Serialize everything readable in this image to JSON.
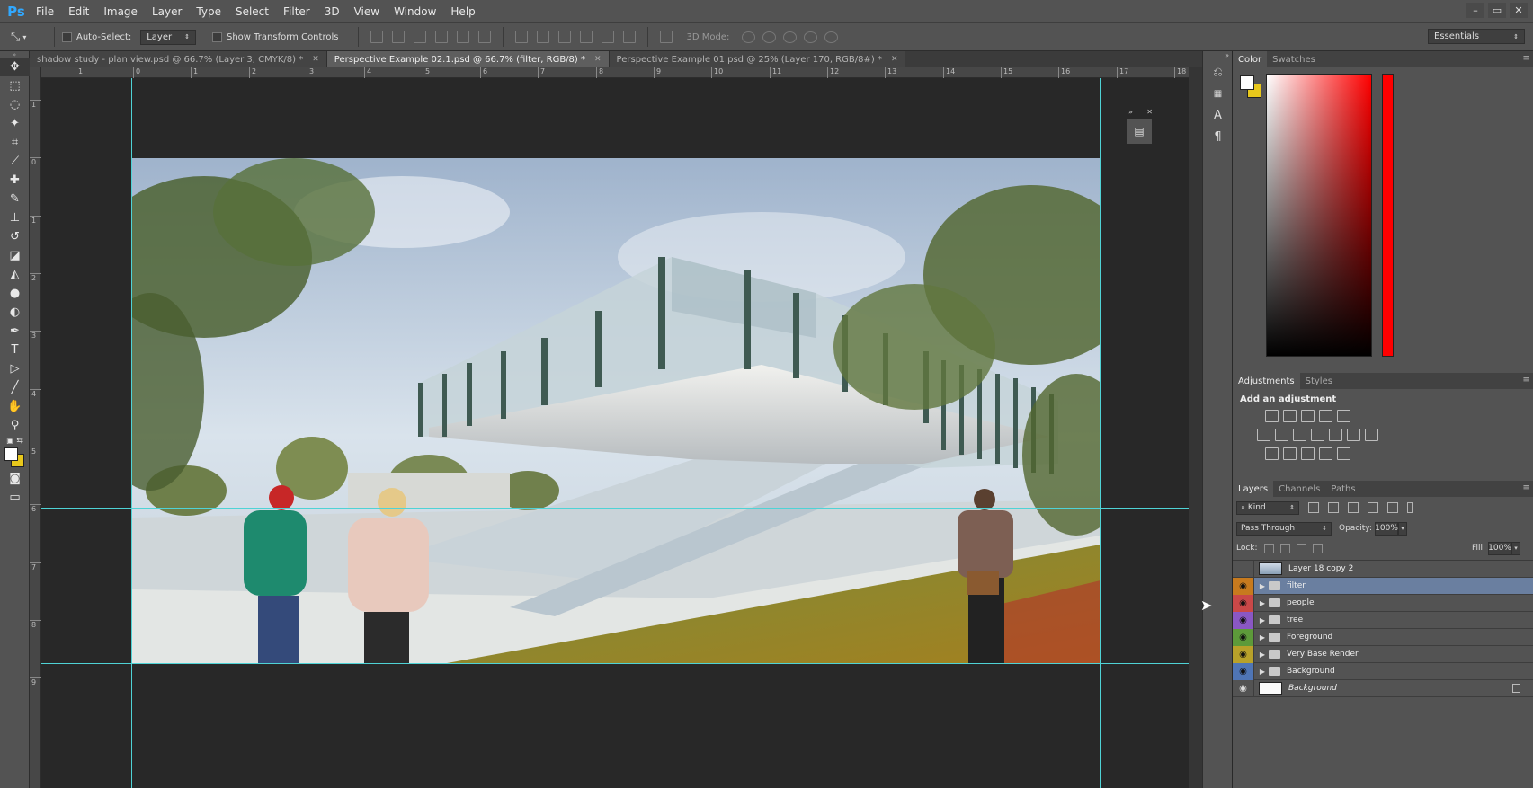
{
  "app": {
    "logo": "Ps"
  },
  "menu": [
    "File",
    "Edit",
    "Image",
    "Layer",
    "Type",
    "Select",
    "Filter",
    "3D",
    "View",
    "Window",
    "Help"
  ],
  "window_controls": [
    "–",
    "▭",
    "✕"
  ],
  "options": {
    "auto_select_label": "Auto-Select:",
    "auto_select_value": "Layer",
    "show_transform_label": "Show Transform Controls",
    "mode3d_label": "3D Mode:",
    "workspace": "Essentials"
  },
  "tabs": [
    {
      "label": "shadow study - plan view.psd @ 66.7% (Layer 3, CMYK/8) *",
      "active": false
    },
    {
      "label": "Perspective Example 02.1.psd @ 66.7% (filter, RGB/8) *",
      "active": true
    },
    {
      "label": "Perspective Example 01.psd @ 25% (Layer 170, RGB/8#) *",
      "active": false
    }
  ],
  "ruler_h": [
    "1",
    "0",
    "1",
    "2",
    "3",
    "4",
    "5",
    "6",
    "7",
    "8",
    "9",
    "10",
    "11",
    "12",
    "13",
    "14",
    "15",
    "16",
    "17",
    "18"
  ],
  "ruler_v": [
    "1",
    "0",
    "1",
    "2",
    "3",
    "4",
    "5",
    "6",
    "7",
    "8",
    "9"
  ],
  "panels": {
    "color": {
      "tabs": [
        "Color",
        "Swatches"
      ],
      "fg": "#ffffff",
      "bg": "#e8c81c"
    },
    "adjustments": {
      "tabs": [
        "Adjustments",
        "Styles"
      ],
      "title": "Add an adjustment"
    },
    "layers": {
      "tabs": [
        "Layers",
        "Channels",
        "Paths"
      ],
      "kind": "Kind",
      "blend_mode": "Pass Through",
      "opacity_label": "Opacity:",
      "opacity": "100%",
      "lock_label": "Lock:",
      "fill_label": "Fill:",
      "fill": "100%",
      "items": [
        {
          "name": "Layer 18 copy 2",
          "type": "image",
          "eye_color": "",
          "visible": false,
          "selected": false
        },
        {
          "name": "filter",
          "type": "group",
          "eye_color": "#c77a1e",
          "visible": true,
          "selected": true
        },
        {
          "name": "people",
          "type": "group",
          "eye_color": "#c94848",
          "visible": true,
          "selected": false
        },
        {
          "name": "tree",
          "type": "group",
          "eye_color": "#8a57c4",
          "visible": true,
          "selected": false
        },
        {
          "name": "Foreground",
          "type": "group",
          "eye_color": "#5d9a3a",
          "visible": true,
          "selected": false
        },
        {
          "name": "Very Base Render",
          "type": "group",
          "eye_color": "#b8a12a",
          "visible": true,
          "selected": false
        },
        {
          "name": "Background",
          "type": "group",
          "eye_color": "#4f75b5",
          "visible": true,
          "selected": false
        },
        {
          "name": "Background",
          "type": "locked",
          "eye_color": "",
          "visible": true,
          "selected": false
        }
      ]
    }
  }
}
